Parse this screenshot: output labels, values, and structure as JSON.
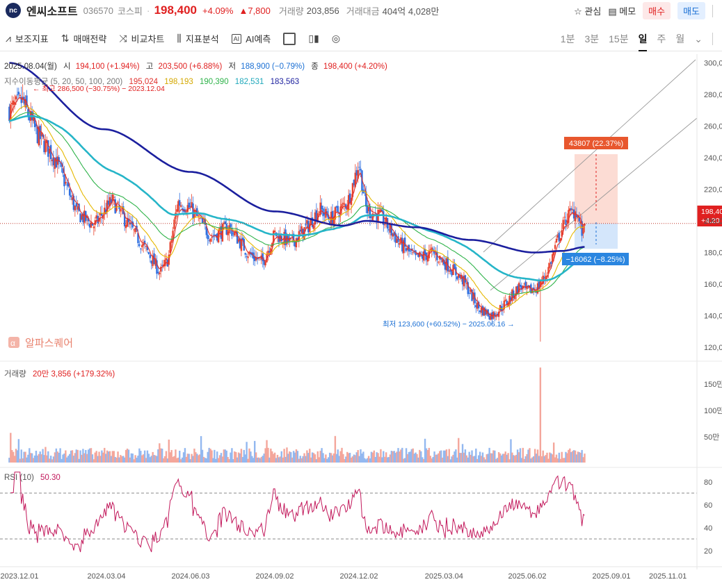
{
  "header": {
    "logo_text": "nc",
    "name": "엔씨소프트",
    "code": "036570",
    "market": "코스피",
    "price": "198,400",
    "change_pct": "+4.09%",
    "change_abs": "▲7,800",
    "volume_label": "거래량",
    "volume": "203,856",
    "amount_label": "거래대금",
    "amount": "404억 4,028만",
    "watch_label": "관심",
    "memo_label": "메모",
    "buy_label": "매수",
    "sell_label": "매도"
  },
  "toolbar": {
    "items": [
      {
        "icon": "indicator-icon",
        "label": "보조지표"
      },
      {
        "icon": "strategy-icon",
        "label": "매매전략"
      },
      {
        "icon": "compare-icon",
        "label": "비교차트"
      },
      {
        "icon": "analysis-icon",
        "label": "지표분석"
      },
      {
        "icon": "ai-icon",
        "label": "AI예측"
      }
    ],
    "periods": [
      "1분",
      "3분",
      "15분",
      "일",
      "주",
      "월"
    ],
    "active_period": "일"
  },
  "info": {
    "date": "2025.08.04(월)",
    "open_label": "시",
    "open": "194,100 (+1.94%)",
    "high_label": "고",
    "high": "203,500 (+6.88%)",
    "low_label": "저",
    "low": "188,900 (−0.79%)",
    "close_label": "종",
    "close": "198,400 (+4.20%)",
    "ma_label": "지수이동평균 (5, 20, 50, 100, 200)",
    "ma_values": [
      "195,024",
      "198,193",
      "190,390",
      "182,531",
      "183,563"
    ],
    "ma_colors": [
      "#e0302c",
      "#e6b800",
      "#2fb34a",
      "#26b5c8",
      "#1b1f9e"
    ],
    "high_note": "← 최고 286,500 (−30.75%) − 2023.12.04",
    "low_note": "최저 123,600 (+60.52%) − 2025.06.16 →",
    "range_up": "43807 (22.37%)",
    "range_down": "−16062 (−8.25%)",
    "price_tag": "198,40",
    "price_tag_pct": "+4.20",
    "watermark": "알파스퀘어"
  },
  "volume_panel": {
    "label": "거래량",
    "value": "20만 3,856 (+179.32%)",
    "ticks": [
      "150만",
      "100만",
      "50만"
    ]
  },
  "rsi_panel": {
    "label": "RSI (10)",
    "value": "50.30",
    "ticks": [
      "80",
      "60",
      "40",
      "20"
    ]
  },
  "price_axis": [
    "300,0",
    "280,0",
    "260,0",
    "240,0",
    "220,0",
    "200,0",
    "180,0",
    "160,0",
    "140,0",
    "120,0"
  ],
  "dates": [
    "2023.12.01",
    "2024.03.04",
    "2024.06.03",
    "2024.09.02",
    "2024.12.02",
    "2025.03.04",
    "2025.06.02",
    "2025.09.01",
    "2025.11.01"
  ],
  "chart_data": {
    "type": "candlestick",
    "anchors": [
      [
        "2023.11.20",
        270000
      ],
      [
        "2023.12.04",
        276000
      ],
      [
        "2023.12.20",
        255000
      ],
      [
        "2024.01.10",
        238000
      ],
      [
        "2024.02.01",
        205000
      ],
      [
        "2024.02.20",
        197000
      ],
      [
        "2024.03.10",
        213000
      ],
      [
        "2024.04.01",
        194000
      ],
      [
        "2024.04.20",
        178000
      ],
      [
        "2024.05.01",
        167000
      ],
      [
        "2024.05.10",
        176000
      ],
      [
        "2024.05.20",
        212000
      ],
      [
        "2024.06.03",
        208000
      ],
      [
        "2024.06.25",
        190000
      ],
      [
        "2024.07.15",
        196000
      ],
      [
        "2024.08.05",
        179000
      ],
      [
        "2024.08.20",
        174000
      ],
      [
        "2024.09.02",
        192000
      ],
      [
        "2024.09.20",
        186000
      ],
      [
        "2024.10.10",
        198000
      ],
      [
        "2024.10.20",
        208000
      ],
      [
        "2024.11.01",
        201000
      ],
      [
        "2024.11.20",
        212000
      ],
      [
        "2024.12.02",
        237000
      ],
      [
        "2024.12.10",
        207000
      ],
      [
        "2024.12.25",
        203000
      ],
      [
        "2025.01.15",
        186000
      ],
      [
        "2025.02.01",
        176000
      ],
      [
        "2025.02.20",
        180000
      ],
      [
        "2025.03.10",
        171000
      ],
      [
        "2025.03.25",
        162000
      ],
      [
        "2025.04.10",
        145000
      ],
      [
        "2025.04.25",
        140000
      ],
      [
        "2025.05.10",
        148000
      ],
      [
        "2025.05.25",
        159000
      ],
      [
        "2025.06.02",
        155000
      ],
      [
        "2025.06.16",
        159000
      ],
      [
        "2025.06.25",
        170000
      ],
      [
        "2025.07.05",
        188000
      ],
      [
        "2025.07.15",
        203000
      ],
      [
        "2025.07.25",
        207000
      ],
      [
        "2025.08.01",
        191000
      ],
      [
        "2025.08.04",
        198400
      ]
    ],
    "ma200_anchors": [
      [
        "2023.11.20",
        300000
      ],
      [
        "2024.03.01",
        258000
      ],
      [
        "2024.06.03",
        231000
      ],
      [
        "2024.09.02",
        206000
      ],
      [
        "2024.11.15",
        197000
      ],
      [
        "2024.12.10",
        200000
      ],
      [
        "2025.02.01",
        196000
      ],
      [
        "2025.04.01",
        188000
      ],
      [
        "2025.06.10",
        180000
      ],
      [
        "2025.07.10",
        181000
      ],
      [
        "2025.08.04",
        183563
      ]
    ],
    "volume_spike": [
      "2025.06.16",
      1800000
    ],
    "rsi_value": 50.3,
    "y_range": [
      113000,
      302000
    ],
    "rsi_levels": [
      70,
      30
    ]
  }
}
